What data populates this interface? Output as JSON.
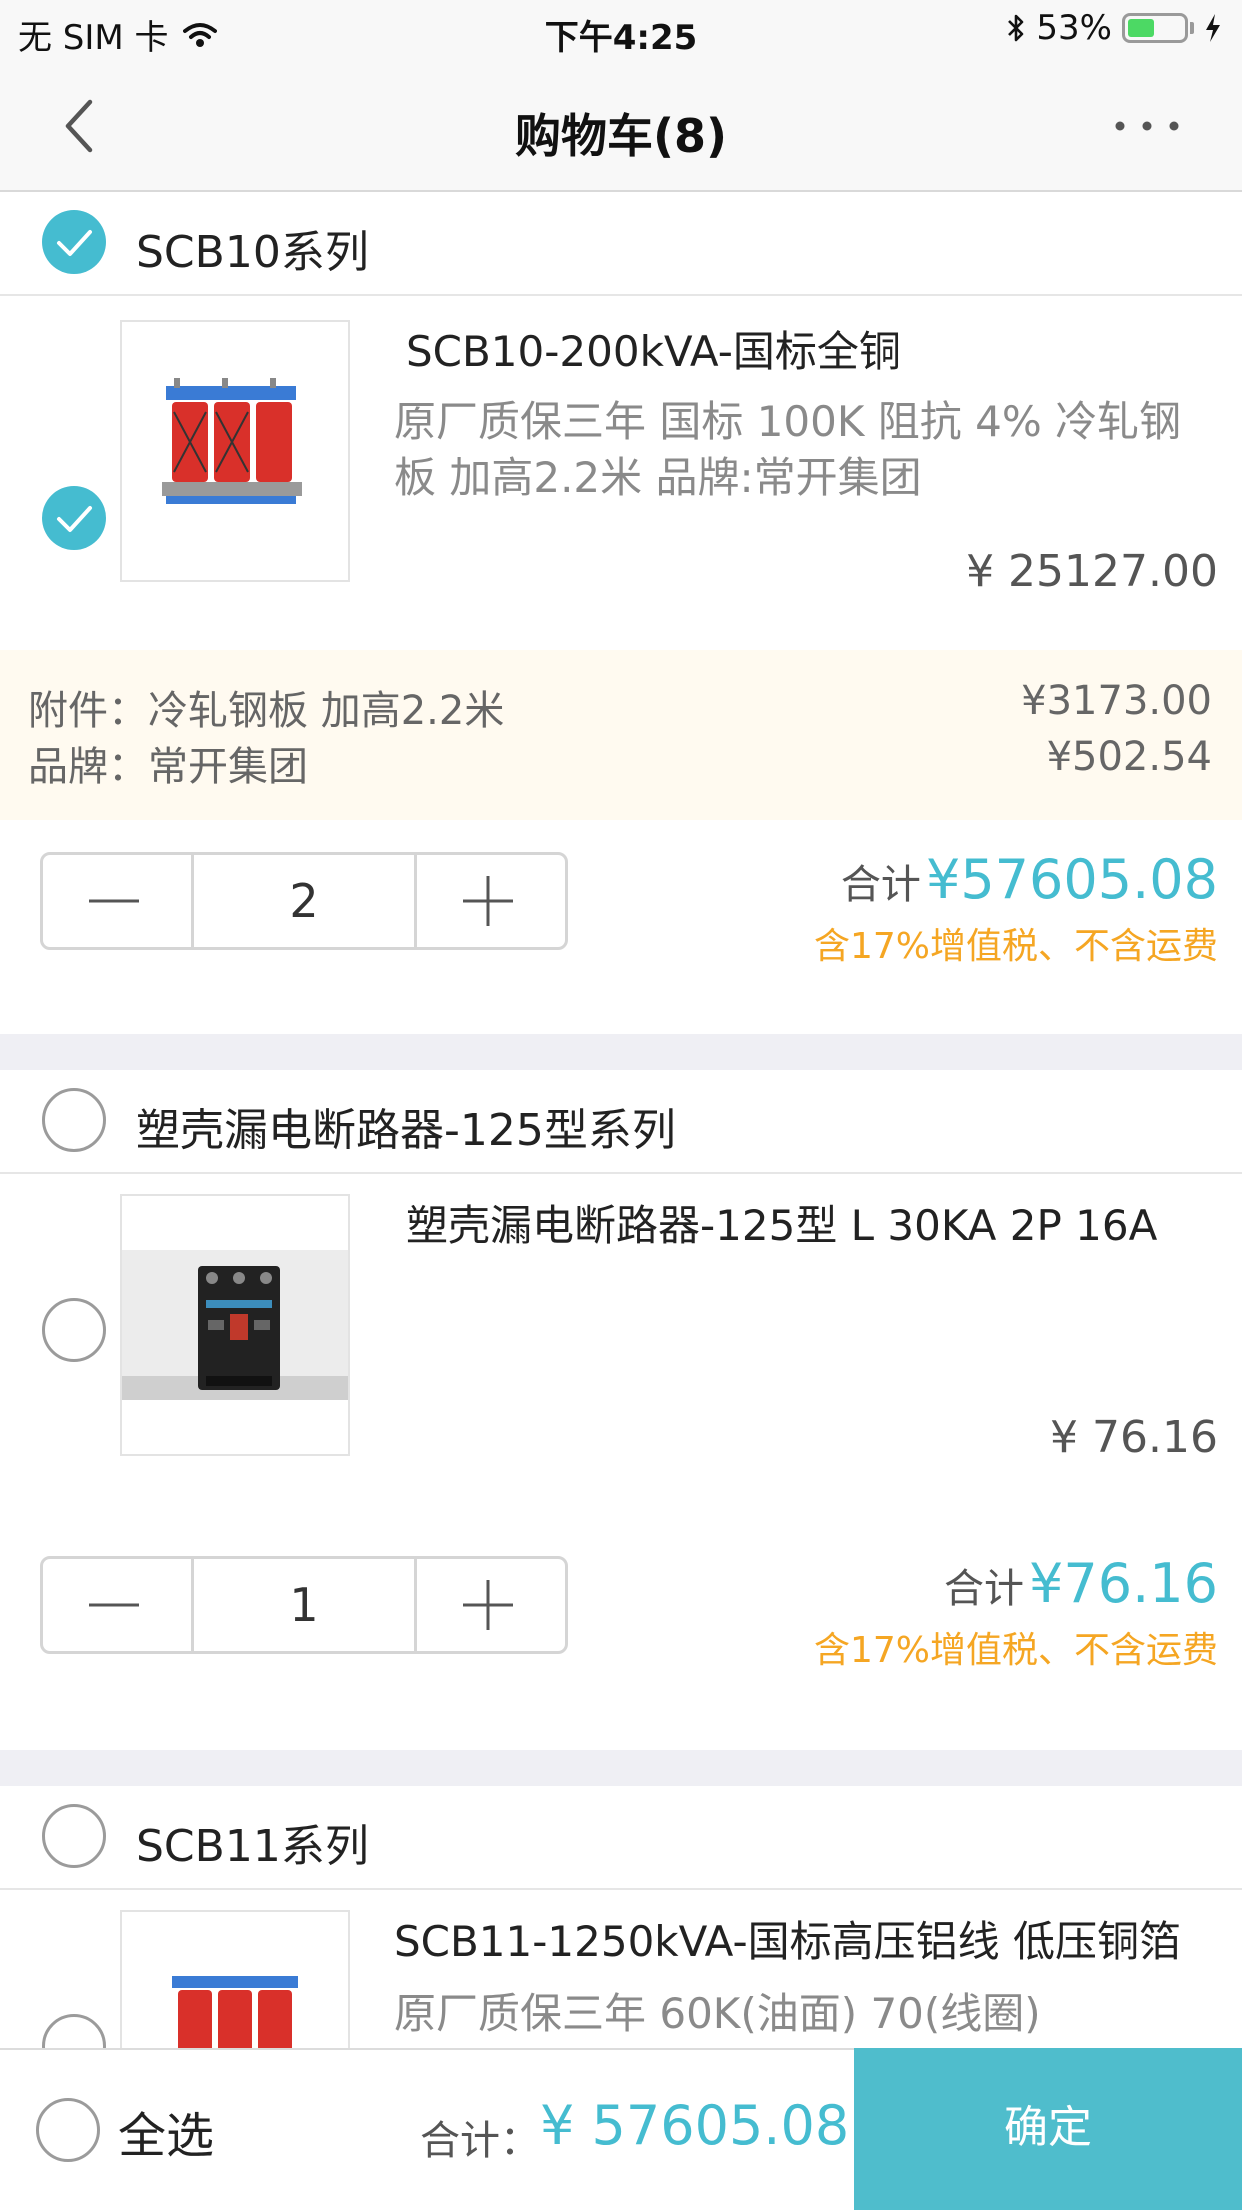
{
  "status_bar": {
    "carrier": "无 SIM 卡",
    "time": "下午4:25",
    "battery": "53%",
    "battery_level": 0.53
  },
  "nav": {
    "title": "购物车(8)",
    "back_icon": "chevron-left-icon",
    "more_icon": "more-dots-icon"
  },
  "groups": [
    {
      "name": "SCB10系列",
      "checked": true,
      "item": {
        "checked": true,
        "name": "SCB10-200kVA-国标全铜",
        "desc": "原厂质保三年 国标 100K 阻抗 4% 冷轧钢板 加高2.2米 品牌:常开集团",
        "price": "¥ 25127.00",
        "extras": [
          {
            "label": "附件：冷轧钢板 加高2.2米",
            "value": "¥3173.00"
          },
          {
            "label": "品牌：常开集团",
            "value": "¥502.54"
          }
        ],
        "qty": "2",
        "subtotal_label": "合计",
        "subtotal": "¥57605.08",
        "tax_note": "含17%增值税、不含运费"
      }
    },
    {
      "name": "塑壳漏电断路器-125型系列",
      "checked": false,
      "item": {
        "checked": false,
        "name": "塑壳漏电断路器-125型 L 30KA 2P 16A",
        "price": "¥ 76.16",
        "qty": "1",
        "subtotal_label": "合计",
        "subtotal": "¥76.16",
        "tax_note": "含17%增值税、不含运费"
      }
    },
    {
      "name": "SCB11系列",
      "checked": false,
      "item": {
        "checked": false,
        "name": "SCB11-1250kVA-国标高压铝线 低压铜箔",
        "desc": "原厂质保三年 60K(油面) 70(线圈)"
      }
    }
  ],
  "footer": {
    "select_all": "全选",
    "total_label": "合计：",
    "total": "¥ 57605.08",
    "confirm": "确定"
  },
  "colors": {
    "accent": "#45bcd0",
    "tax_note": "#f5a623",
    "extras_bg": "#fffaf0"
  }
}
